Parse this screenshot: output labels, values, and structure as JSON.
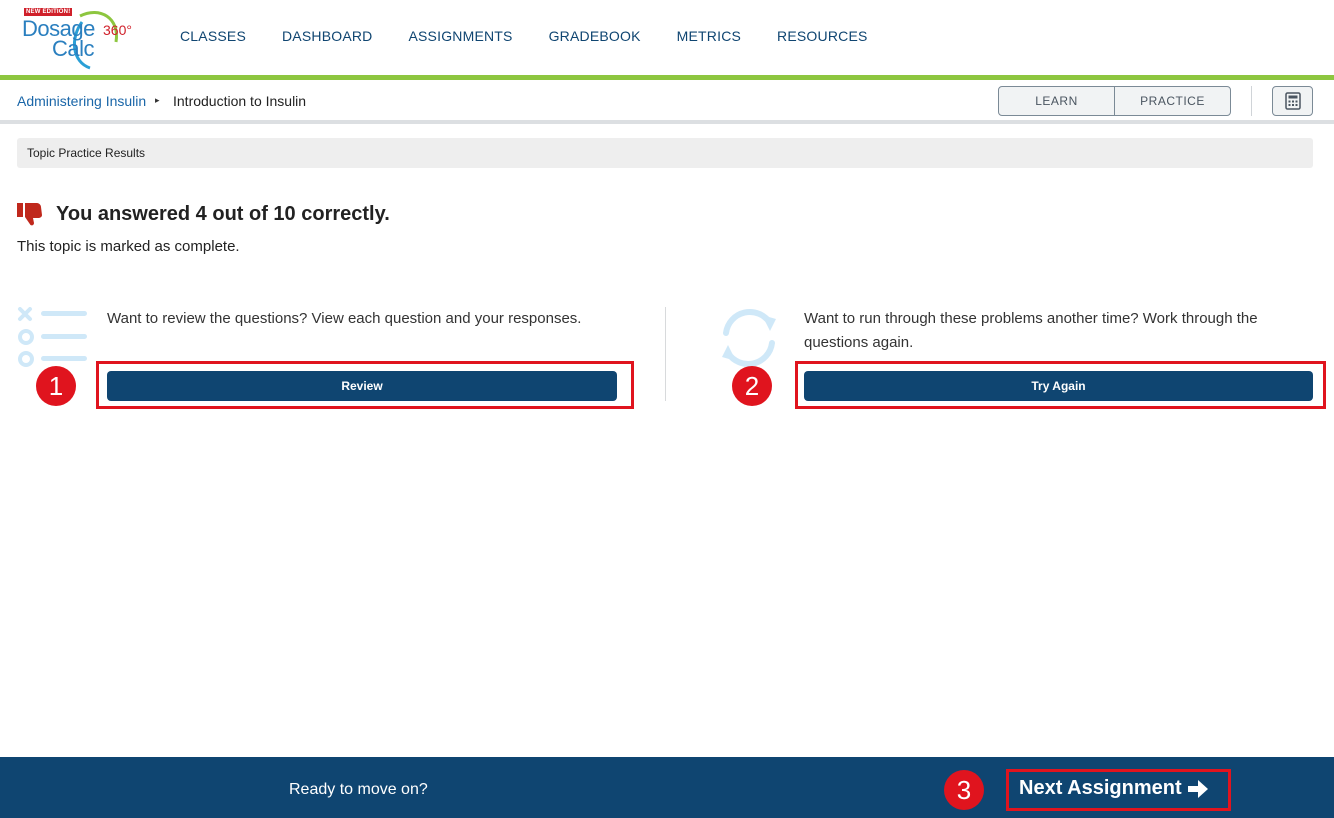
{
  "logo": {
    "badge": "NEW EDITION!",
    "word1": "Dosage",
    "word2": "Calc",
    "word3": "360°"
  },
  "nav": [
    "CLASSES",
    "DASHBOARD",
    "ASSIGNMENTS",
    "GRADEBOOK",
    "METRICS",
    "RESOURCES"
  ],
  "breadcrumb": {
    "parent": "Administering Insulin",
    "separator": "▸",
    "current": "Introduction to Insulin"
  },
  "mode_toggle": {
    "learn": "LEARN",
    "practice": "PRACTICE"
  },
  "calculator_icon": "calculator-icon",
  "section_label": "Topic Practice Results",
  "result": {
    "title": "You answered 4 out of 10 correctly.",
    "icon": "thumbs-down-icon",
    "status": "This topic is marked as complete."
  },
  "review": {
    "icon": "checklist-icon",
    "text": "Want to review the questions? View each question and your responses.",
    "button": "Review"
  },
  "try_again": {
    "icon": "refresh-icon",
    "text": "Want to run through these problems another time? Work through the questions again.",
    "button": "Try Again"
  },
  "footer": {
    "prompt": "Ready to move on?",
    "next": "Next Assignment"
  },
  "annotations": [
    "1",
    "2",
    "3"
  ],
  "colors": {
    "brand": "#0f4571",
    "accent_green": "#8dc63f",
    "annotation_red": "#e0141e",
    "thumb_red": "#c0281c",
    "icon_light_blue": "#cfe8f8"
  }
}
